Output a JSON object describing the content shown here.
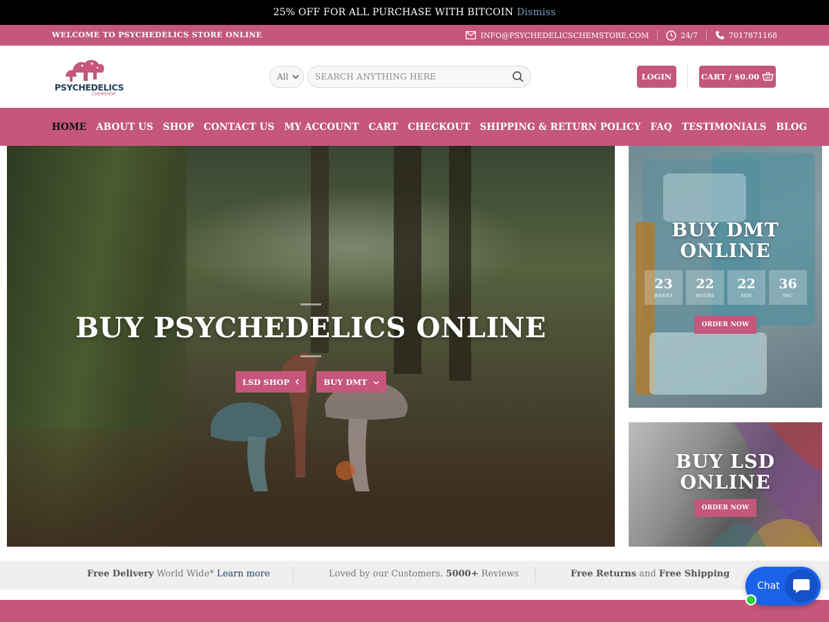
{
  "notice": {
    "text": "25% OFF FOR ALL PURCHASE WITH BITCOIN",
    "dismiss": "Dismiss"
  },
  "topbar": {
    "welcome": "WELCOME TO PSYCHEDELICS STORE ONLINE",
    "email": "INFO@PSYCHEDELICSCHEMSTORE.COM",
    "hours": "24/7",
    "phone": "7017871168"
  },
  "header": {
    "logo_text": "PSYCHEDELICS",
    "logo_sub": "CHEMSHOP",
    "category": "All",
    "search_placeholder": "SEARCH ANYTHING HERE",
    "login": "LOGIN",
    "cart": "CART / $0.00"
  },
  "nav": {
    "items": [
      {
        "label": "HOME"
      },
      {
        "label": "ABOUT US"
      },
      {
        "label": "SHOP"
      },
      {
        "label": "CONTACT US"
      },
      {
        "label": "MY ACCOUNT"
      },
      {
        "label": "CART"
      },
      {
        "label": "CHECKOUT"
      },
      {
        "label": "SHIPPING & RETURN POLICY"
      },
      {
        "label": "FAQ"
      },
      {
        "label": "TESTIMONIALS"
      },
      {
        "label": "BLOG"
      }
    ]
  },
  "hero": {
    "title": "BUY PSYCHEDELICS ONLINE",
    "btn1": "LSD SHOP",
    "btn2": "BUY DMT"
  },
  "promo1": {
    "title_line1": "BUY DMT",
    "title_line2": "ONLINE",
    "countdown": [
      {
        "num": "23",
        "label": "WEEKS"
      },
      {
        "num": "22",
        "label": "HOURS"
      },
      {
        "num": "22",
        "label": "MIN"
      },
      {
        "num": "36",
        "label": "SEC"
      }
    ],
    "button": "ORDER NOW"
  },
  "promo2": {
    "title_line1": "BUY LSD",
    "title_line2": "ONLINE",
    "button": "ORDER NOW"
  },
  "features": {
    "f1_bold": "Free Delivery",
    "f1_text": "World Wide*",
    "f1_link": "Learn more",
    "f2_text": "Loved by our Customers.",
    "f2_bold": "5000+",
    "f2_tail": "Reviews",
    "f3_bold1": "Free Returns",
    "f3_and": "and",
    "f3_bold2": "Free Shipping"
  },
  "chat": {
    "label": "Chat"
  },
  "colors": {
    "brand": "#c4577a",
    "notice_bg": "#000000",
    "chat": "#1b62ea"
  }
}
